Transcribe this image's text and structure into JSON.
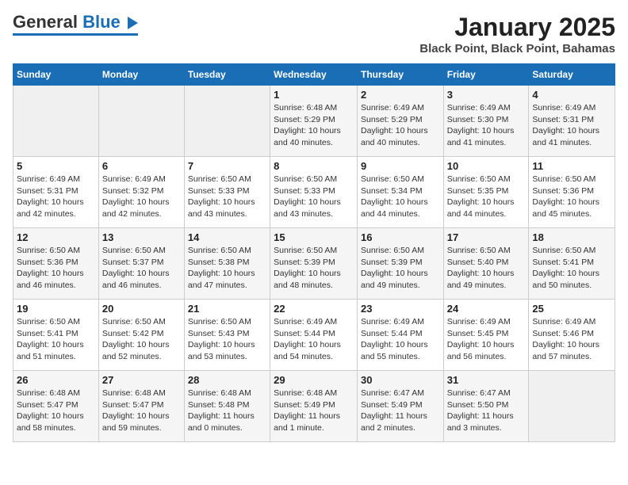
{
  "header": {
    "logo_general": "General",
    "logo_blue": "Blue",
    "title": "January 2025",
    "subtitle": "Black Point, Black Point, Bahamas"
  },
  "days_of_week": [
    "Sunday",
    "Monday",
    "Tuesday",
    "Wednesday",
    "Thursday",
    "Friday",
    "Saturday"
  ],
  "weeks": [
    [
      {
        "day": "",
        "info": ""
      },
      {
        "day": "",
        "info": ""
      },
      {
        "day": "",
        "info": ""
      },
      {
        "day": "1",
        "info": "Sunrise: 6:48 AM\nSunset: 5:29 PM\nDaylight: 10 hours\nand 40 minutes."
      },
      {
        "day": "2",
        "info": "Sunrise: 6:49 AM\nSunset: 5:29 PM\nDaylight: 10 hours\nand 40 minutes."
      },
      {
        "day": "3",
        "info": "Sunrise: 6:49 AM\nSunset: 5:30 PM\nDaylight: 10 hours\nand 41 minutes."
      },
      {
        "day": "4",
        "info": "Sunrise: 6:49 AM\nSunset: 5:31 PM\nDaylight: 10 hours\nand 41 minutes."
      }
    ],
    [
      {
        "day": "5",
        "info": "Sunrise: 6:49 AM\nSunset: 5:31 PM\nDaylight: 10 hours\nand 42 minutes."
      },
      {
        "day": "6",
        "info": "Sunrise: 6:49 AM\nSunset: 5:32 PM\nDaylight: 10 hours\nand 42 minutes."
      },
      {
        "day": "7",
        "info": "Sunrise: 6:50 AM\nSunset: 5:33 PM\nDaylight: 10 hours\nand 43 minutes."
      },
      {
        "day": "8",
        "info": "Sunrise: 6:50 AM\nSunset: 5:33 PM\nDaylight: 10 hours\nand 43 minutes."
      },
      {
        "day": "9",
        "info": "Sunrise: 6:50 AM\nSunset: 5:34 PM\nDaylight: 10 hours\nand 44 minutes."
      },
      {
        "day": "10",
        "info": "Sunrise: 6:50 AM\nSunset: 5:35 PM\nDaylight: 10 hours\nand 44 minutes."
      },
      {
        "day": "11",
        "info": "Sunrise: 6:50 AM\nSunset: 5:36 PM\nDaylight: 10 hours\nand 45 minutes."
      }
    ],
    [
      {
        "day": "12",
        "info": "Sunrise: 6:50 AM\nSunset: 5:36 PM\nDaylight: 10 hours\nand 46 minutes."
      },
      {
        "day": "13",
        "info": "Sunrise: 6:50 AM\nSunset: 5:37 PM\nDaylight: 10 hours\nand 46 minutes."
      },
      {
        "day": "14",
        "info": "Sunrise: 6:50 AM\nSunset: 5:38 PM\nDaylight: 10 hours\nand 47 minutes."
      },
      {
        "day": "15",
        "info": "Sunrise: 6:50 AM\nSunset: 5:39 PM\nDaylight: 10 hours\nand 48 minutes."
      },
      {
        "day": "16",
        "info": "Sunrise: 6:50 AM\nSunset: 5:39 PM\nDaylight: 10 hours\nand 49 minutes."
      },
      {
        "day": "17",
        "info": "Sunrise: 6:50 AM\nSunset: 5:40 PM\nDaylight: 10 hours\nand 49 minutes."
      },
      {
        "day": "18",
        "info": "Sunrise: 6:50 AM\nSunset: 5:41 PM\nDaylight: 10 hours\nand 50 minutes."
      }
    ],
    [
      {
        "day": "19",
        "info": "Sunrise: 6:50 AM\nSunset: 5:41 PM\nDaylight: 10 hours\nand 51 minutes."
      },
      {
        "day": "20",
        "info": "Sunrise: 6:50 AM\nSunset: 5:42 PM\nDaylight: 10 hours\nand 52 minutes."
      },
      {
        "day": "21",
        "info": "Sunrise: 6:50 AM\nSunset: 5:43 PM\nDaylight: 10 hours\nand 53 minutes."
      },
      {
        "day": "22",
        "info": "Sunrise: 6:49 AM\nSunset: 5:44 PM\nDaylight: 10 hours\nand 54 minutes."
      },
      {
        "day": "23",
        "info": "Sunrise: 6:49 AM\nSunset: 5:44 PM\nDaylight: 10 hours\nand 55 minutes."
      },
      {
        "day": "24",
        "info": "Sunrise: 6:49 AM\nSunset: 5:45 PM\nDaylight: 10 hours\nand 56 minutes."
      },
      {
        "day": "25",
        "info": "Sunrise: 6:49 AM\nSunset: 5:46 PM\nDaylight: 10 hours\nand 57 minutes."
      }
    ],
    [
      {
        "day": "26",
        "info": "Sunrise: 6:48 AM\nSunset: 5:47 PM\nDaylight: 10 hours\nand 58 minutes."
      },
      {
        "day": "27",
        "info": "Sunrise: 6:48 AM\nSunset: 5:47 PM\nDaylight: 10 hours\nand 59 minutes."
      },
      {
        "day": "28",
        "info": "Sunrise: 6:48 AM\nSunset: 5:48 PM\nDaylight: 11 hours\nand 0 minutes."
      },
      {
        "day": "29",
        "info": "Sunrise: 6:48 AM\nSunset: 5:49 PM\nDaylight: 11 hours\nand 1 minute."
      },
      {
        "day": "30",
        "info": "Sunrise: 6:47 AM\nSunset: 5:49 PM\nDaylight: 11 hours\nand 2 minutes."
      },
      {
        "day": "31",
        "info": "Sunrise: 6:47 AM\nSunset: 5:50 PM\nDaylight: 11 hours\nand 3 minutes."
      },
      {
        "day": "",
        "info": ""
      }
    ]
  ]
}
